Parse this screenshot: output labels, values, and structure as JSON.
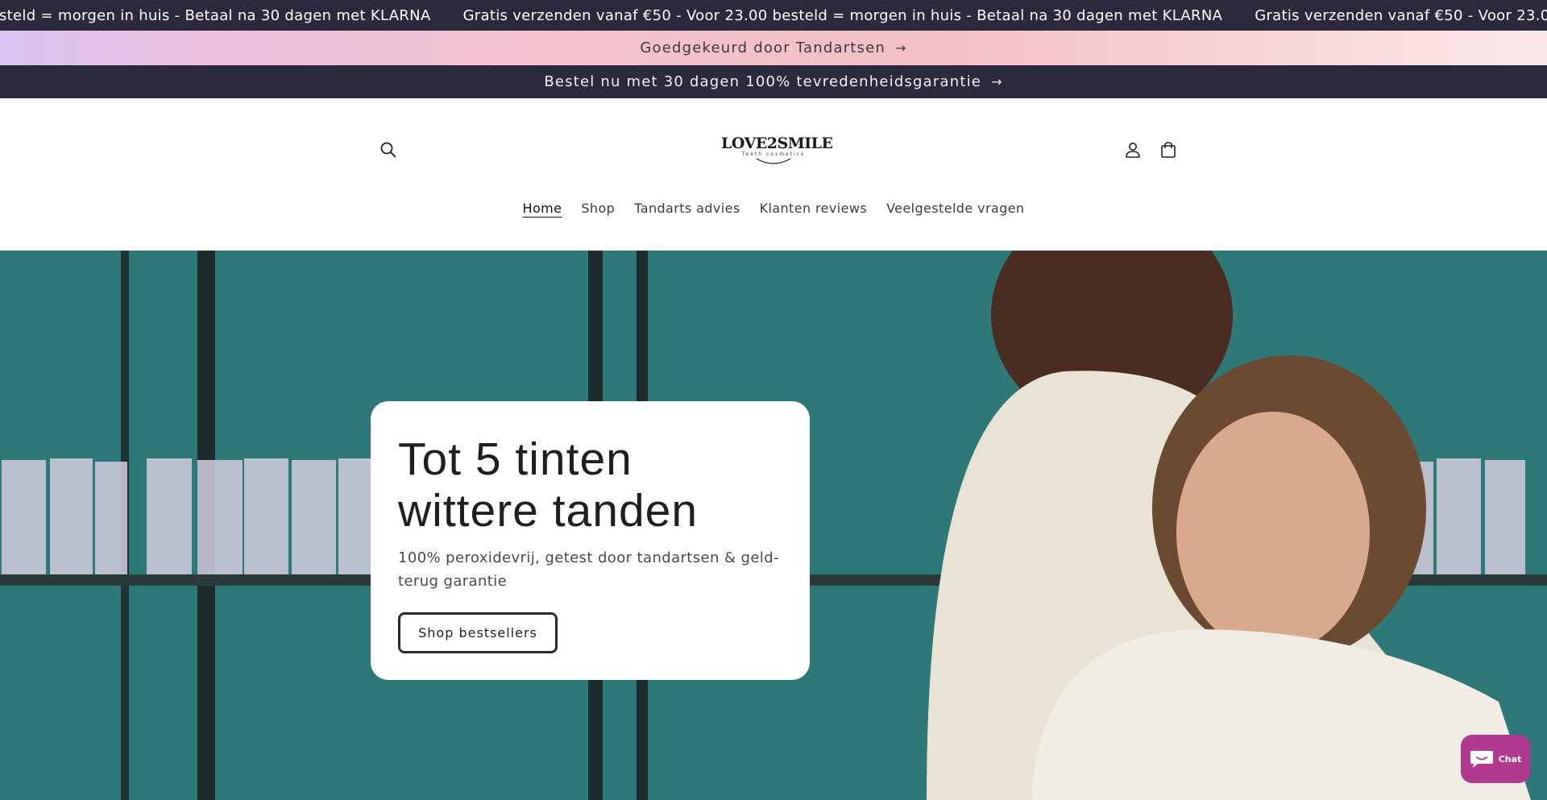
{
  "announcement_marquee": {
    "items": [
      "Gratis verzenden vanaf €50 - Voor 23.00 besteld = morgen in huis - Betaal na 30 dagen met KLARNA",
      "Gratis verzenden vanaf €50 - Voor 23.00 besteld = morgen in huis - Betaal na 30 dagen met KLARNA",
      "Gratis verzenden vanaf €50 - Voor 23.00 besteld = morgen in huis - Betaal na 30 dagen met KLARNA"
    ],
    "first_visible_fragment": "steld = morgen in huis - Betaal na 30 dagen met KLARNA"
  },
  "announcement_bars": {
    "dentists": "Goedgekeurd door Tandartsen",
    "guarantee": "Bestel nu met 30 dagen 100% tevredenheidsgarantie",
    "arrow_icon": "arrow-right-icon"
  },
  "header": {
    "logo_text": "LOVE2SMILE",
    "logo_tagline": "Teeth cosmetics",
    "icons": {
      "search": "search-icon",
      "account": "user-icon",
      "cart": "bag-icon"
    }
  },
  "nav": {
    "items": [
      "Home",
      "Shop",
      "Tandarts advies",
      "Klanten reviews",
      "Veelgestelde vragen"
    ],
    "active": "Home"
  },
  "hero": {
    "title_line1": "Tot 5 tinten",
    "title_line2": "wittere tanden",
    "subtitle": "100% peroxidevrij, getest door tandartsen & geld-terug garantie",
    "cta": "Shop bestsellers"
  },
  "chat": {
    "label": "Chat",
    "icon": "chat-bubble-icon"
  },
  "colors": {
    "dark_bar": "#2b2a3d",
    "hero_teal": "#2f7a7a",
    "chat_accent": "#b03a8f"
  }
}
